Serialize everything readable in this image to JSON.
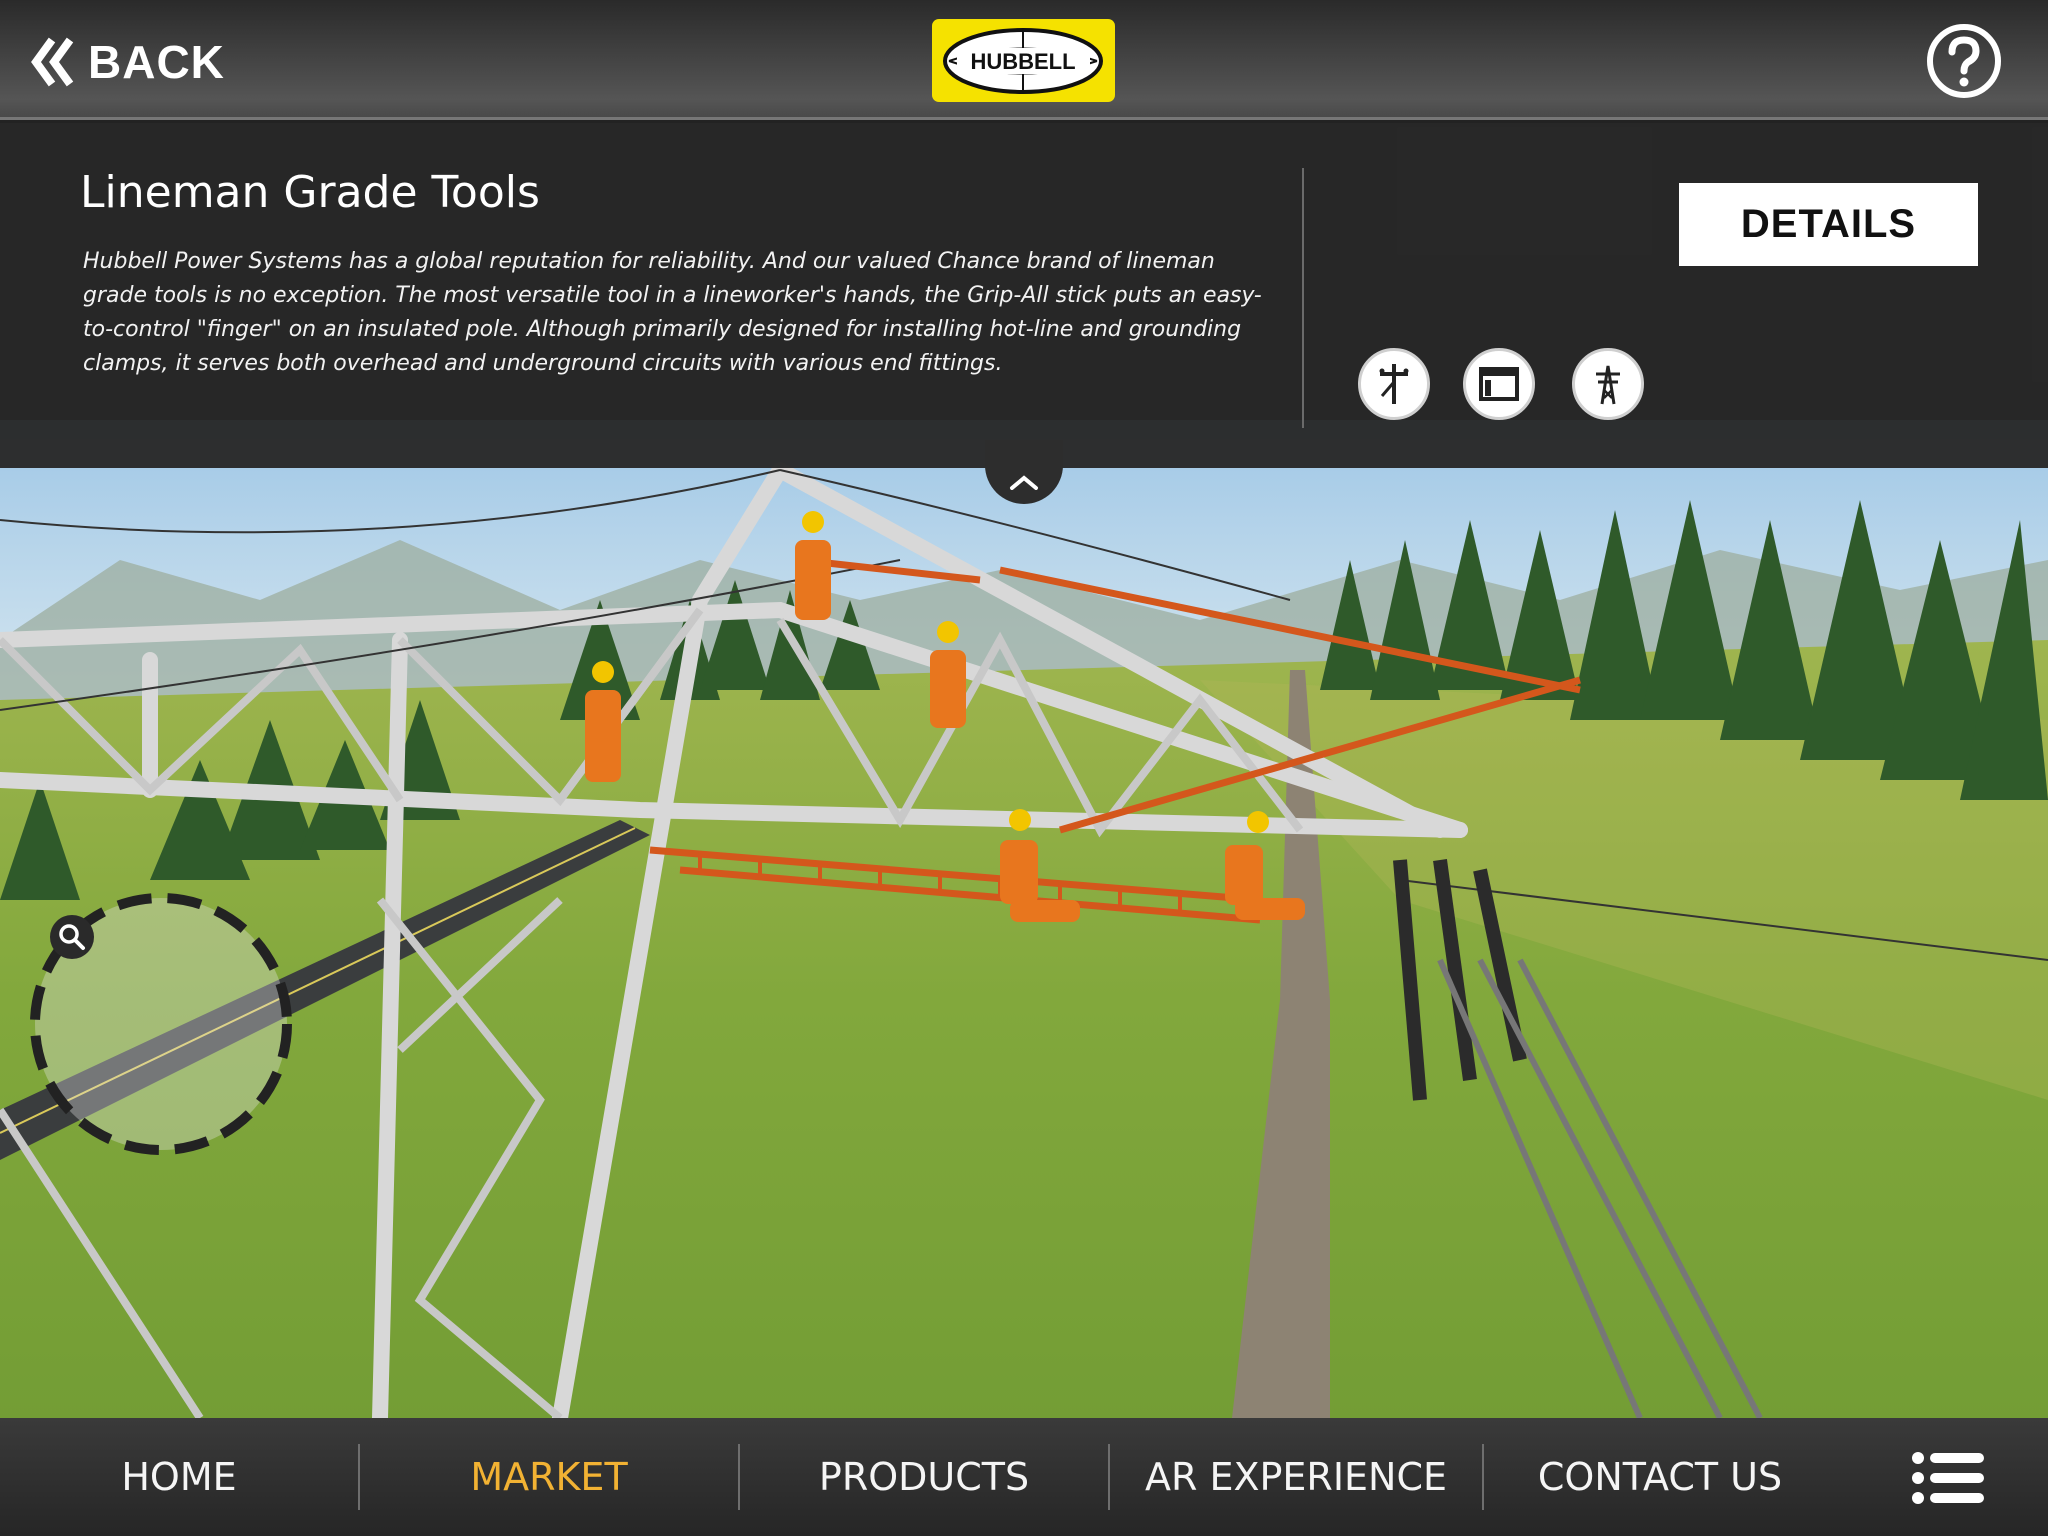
{
  "header": {
    "back_label": "BACK",
    "logo_text": "HUBBELL",
    "help_icon": "question-mark-icon"
  },
  "info_panel": {
    "title": "Lineman Grade Tools",
    "description": "Hubbell Power Systems has a global reputation for reliability. And our valued Chance brand of lineman grade tools is no exception. The most versatile tool in a lineworker's hands, the Grip-All stick puts an easy-to-control \"finger\" on an insulated pole. Although primarily designed for installing hot-line and grounding clamps, it serves both overhead and underground circuits with various end fittings.",
    "details_label": "DETAILS",
    "view_icons": [
      "distribution-pole-icon",
      "panel-view-icon",
      "transmission-tower-icon"
    ]
  },
  "nav": {
    "items": [
      {
        "label": "HOME",
        "active": false
      },
      {
        "label": "MARKET",
        "active": true
      },
      {
        "label": "PRODUCTS",
        "active": false
      },
      {
        "label": "AR EXPERIENCE",
        "active": false
      },
      {
        "label": "CONTACT US",
        "active": false
      }
    ],
    "menu_icon": "hamburger-menu-icon"
  },
  "colors": {
    "accent": "#f2b233",
    "logo_yellow": "#f5e200",
    "panel_bg": "#282828",
    "worker_orange": "#e8761e"
  }
}
